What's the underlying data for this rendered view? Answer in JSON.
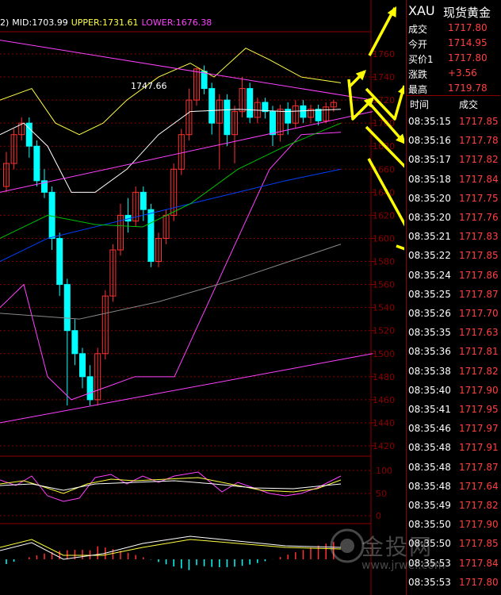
{
  "header": {
    "prefix": "2)",
    "mid": "MID:1703.99",
    "upper": "UPPER:1731.61",
    "lower": "LOWER:1676.38"
  },
  "annotation": "1747.66",
  "yaxis_main": [
    "1760",
    "1740",
    "1720",
    "1700",
    "1680",
    "1660",
    "1640",
    "1620",
    "1600",
    "1580",
    "1560",
    "1540",
    "1520",
    "1500",
    "1480",
    "1460",
    "1440",
    "1420"
  ],
  "yaxis_osc": [
    "100",
    "50",
    "0"
  ],
  "quote": {
    "symbol": "XAU",
    "name": "现货黄金",
    "rows": [
      {
        "label": "成交",
        "value": "1717.80"
      },
      {
        "label": "今开",
        "value": "1714.95"
      },
      {
        "label": "买价1",
        "value": "1717.80"
      },
      {
        "label": "涨跌",
        "value": "+3.56"
      },
      {
        "label": "最高",
        "value": "1719.78"
      }
    ]
  },
  "ticks": {
    "col_time": "时间",
    "col_price": "成交",
    "rows": [
      {
        "time": "08:35:15",
        "price": "1717.85"
      },
      {
        "time": "08:35:16",
        "price": "1717.78"
      },
      {
        "time": "08:35:17",
        "price": "1717.82"
      },
      {
        "time": "08:35:18",
        "price": "1717.84"
      },
      {
        "time": "08:35:20",
        "price": "1717.75"
      },
      {
        "time": "08:35:20",
        "price": "1717.76"
      },
      {
        "time": "08:35:21",
        "price": "1717.83"
      },
      {
        "time": "08:35:22",
        "price": "1717.85"
      },
      {
        "time": "08:35:24",
        "price": "1717.86"
      },
      {
        "time": "08:35:25",
        "price": "1717.87"
      },
      {
        "time": "08:35:26",
        "price": "1717.70"
      },
      {
        "time": "08:35:35",
        "price": "1717.63"
      },
      {
        "time": "08:35:36",
        "price": "1717.81"
      },
      {
        "time": "08:35:38",
        "price": "1717.82"
      },
      {
        "time": "08:35:40",
        "price": "1717.90"
      },
      {
        "time": "08:35:41",
        "price": "1717.95"
      },
      {
        "time": "08:35:46",
        "price": "1717.97"
      },
      {
        "time": "08:35:48",
        "price": "1717.91"
      },
      {
        "time": "08:35:48",
        "price": "1717.87"
      },
      {
        "time": "08:35:48",
        "price": "1717.64"
      },
      {
        "time": "08:35:49",
        "price": "1717.82"
      },
      {
        "time": "08:35:50",
        "price": "1717.90"
      },
      {
        "time": "08:35:50",
        "price": "1717.85"
      },
      {
        "time": "08:35:53",
        "price": "1717.84"
      },
      {
        "time": "08:35:53",
        "price": "1717.80"
      }
    ]
  },
  "watermark": {
    "text": "金投网",
    "url": "www.jrwel.com"
  },
  "colors": {
    "up": "#ff3030",
    "down": "#00ffff",
    "mid": "#ffffff",
    "upper": "#ffff40",
    "lower": "#ff40ff",
    "arrow": "#ffff00",
    "grid": "#8b0000"
  }
}
